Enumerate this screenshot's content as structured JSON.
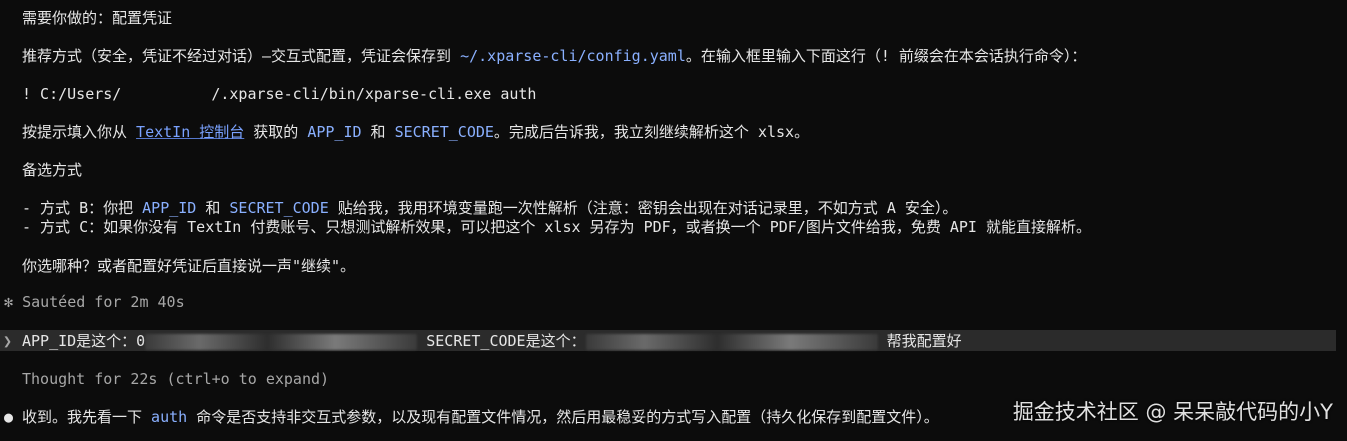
{
  "lines": {
    "l1": "需要你做的：配置凭证",
    "l2_a": "推荐方式（安全，凭证不经过对话）—交互式配置，凭证会保存到 ",
    "l2_path": "~/.xparse-cli/config.yaml",
    "l2_b": "。在输入框里输入下面这行（! 前缀会在本会话执行命令）：",
    "l3_a": "! C:/Users/",
    "l3_b": "/.xparse-cli/bin/xparse-cli.exe auth",
    "l4_a": "按提示填入你从 ",
    "l4_link": "TextIn 控制台",
    "l4_b": " 获取的 ",
    "l4_app": "APP_ID",
    "l4_c": " 和 ",
    "l4_secret": "SECRET_CODE",
    "l4_d": "。完成后告诉我，我立刻继续解析这个 xlsx。",
    "l5": "备选方式",
    "l6_a": "- 方式 B：你把 ",
    "l6_app": "APP_ID",
    "l6_b": " 和 ",
    "l6_secret": "SECRET_CODE",
    "l6_c": " 贴给我，我用环境变量跑一次性解析（注意：密钥会出现在对话记录里，不如方式 A 安全）。",
    "l7": "- 方式 C：如果你没有 TextIn 付费账号、只想测试解析效果，可以把这个 xlsx 另存为 PDF，或者换一个 PDF/图片文件给我，免费 API 就能直接解析。",
    "l8": "你选哪种？或者配置好凭证后直接说一声\"继续\"。",
    "sauteed_glyph": "✻",
    "sauteed": "Sautéed for 2m 40s",
    "user_glyph": "❯",
    "user_a": "APP_ID是这个：0",
    "user_b": "SECRET_CODE是这个：",
    "user_c": "帮我配置好",
    "thought": "Thought for 22s (ctrl+o to expand)",
    "bullet": "●",
    "reply_a": "收到。我先看一下 ",
    "reply_auth": "auth",
    "reply_b": " 命令是否支持非交互式参数，以及现有配置文件情况，然后用最稳妥的方式写入配置（持久化保存到配置文件）。"
  },
  "watermark": "掘金技术社区 @ 呆呆敲代码的小Y",
  "colors": {
    "background": "#0c0c0c",
    "text": "#e6e6e6",
    "highlight": "#8ab0ff",
    "user_bar": "#2b2b2b"
  }
}
